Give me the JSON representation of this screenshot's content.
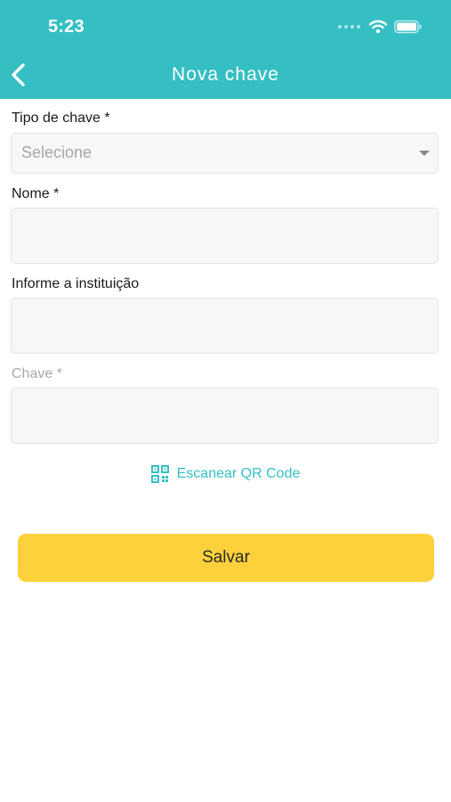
{
  "status_bar": {
    "time": "5:23"
  },
  "header": {
    "title": "Nova chave",
    "back_icon": "chevron-left-icon"
  },
  "form": {
    "tipo_label": "Tipo de chave *",
    "tipo_placeholder": "Selecione",
    "nome_label": "Nome *",
    "nome_value": "",
    "instituicao_label": "Informe a instituição",
    "instituicao_value": "",
    "chave_label": "Chave *",
    "chave_value": ""
  },
  "qr": {
    "label": "Escanear QR Code",
    "icon": "qr-code-icon"
  },
  "actions": {
    "save_label": "Salvar"
  },
  "colors": {
    "accent": "#35bfc3",
    "button": "#fdd13b"
  }
}
